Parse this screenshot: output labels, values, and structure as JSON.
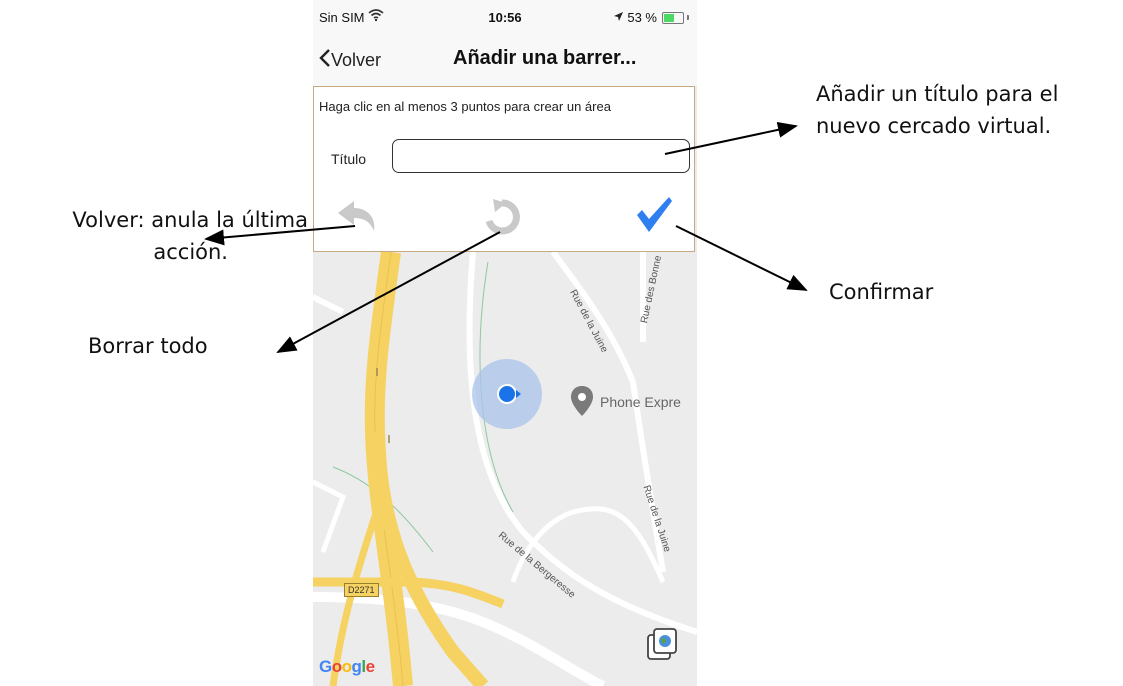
{
  "status_bar": {
    "carrier": "Sin SIM",
    "time": "10:56",
    "battery": "53 %",
    "battery_level": 0.53
  },
  "nav": {
    "back_label": "Volver",
    "title": "Añadir una barrer..."
  },
  "panel": {
    "hint": "Haga clic en al menos 3 puntos para crear un área",
    "title_label": "Título",
    "title_value": "",
    "icons": {
      "undo": "undo-arrow-icon",
      "reset": "reset-circular-arrow-icon",
      "confirm": "checkmark-icon"
    }
  },
  "map": {
    "streets": [
      "Rue de la Juine",
      "Rue des Bonne",
      "Rue de la Juine",
      "Rue de la Bergeresse"
    ],
    "poi": "Phone Expre",
    "road_shield": "D2271",
    "logo": "Google",
    "colors": {
      "highway": "#f5d262",
      "location": "#1a73e8",
      "checkmark": "#2f7ff0"
    }
  },
  "annotations": {
    "add_title_line1": "Añadir un título para el",
    "add_title_line2": "nuevo cercado virtual.",
    "confirm": "Confirmar",
    "clear_all": "Borrar todo",
    "undo_line1": "Volver: anula la última",
    "undo_line2": "acción."
  }
}
